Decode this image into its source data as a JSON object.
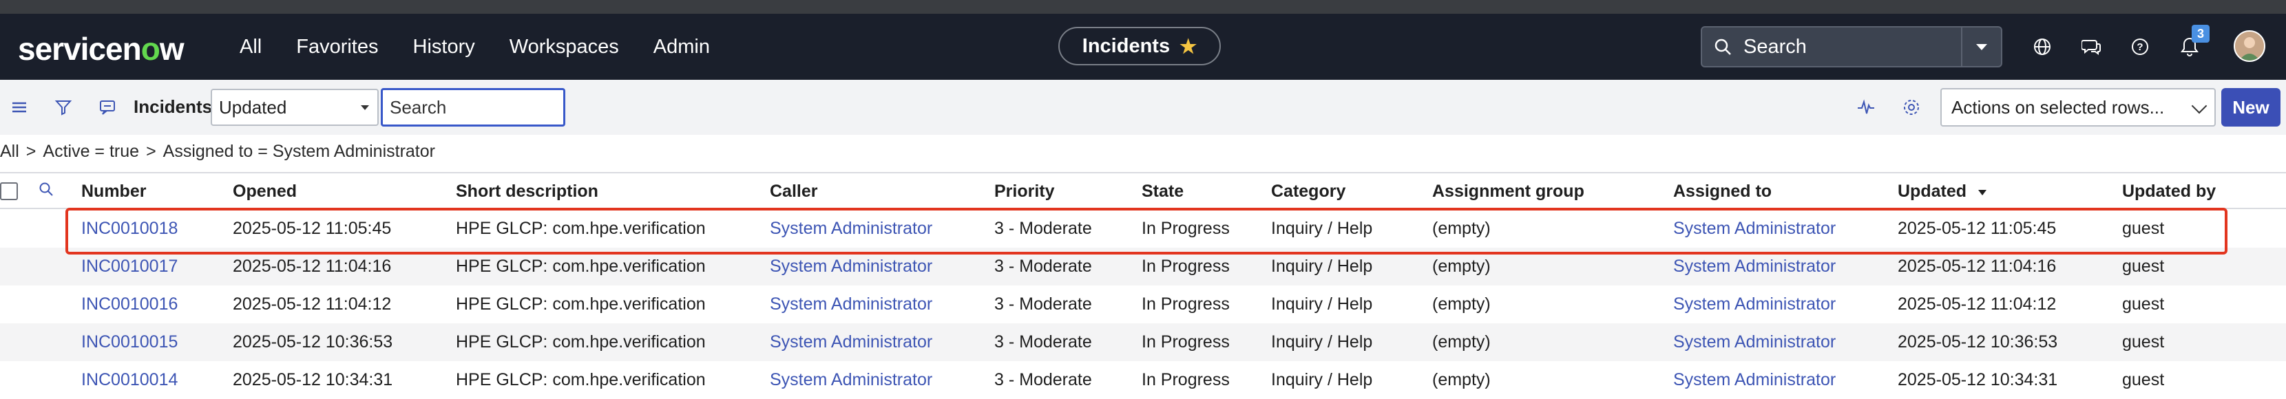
{
  "nav": {
    "logo_pre": "servicen",
    "logo_o": "o",
    "logo_post": "w",
    "menu": [
      "All",
      "Favorites",
      "History",
      "Workspaces",
      "Admin"
    ],
    "current_page": "Incidents",
    "search_placeholder": "Search",
    "notification_count": "3"
  },
  "toolbar": {
    "title": "Incidents",
    "sort_field": "Updated",
    "search_placeholder": "Search",
    "actions_label": "Actions on selected rows...",
    "new_label": "New"
  },
  "breadcrumb": {
    "items": [
      "All",
      ">",
      "Active = true",
      ">",
      "Assigned to = System Administrator"
    ]
  },
  "table": {
    "columns": [
      "Number",
      "Opened",
      "Short description",
      "Caller",
      "Priority",
      "State",
      "Category",
      "Assignment group",
      "Assigned to",
      "Updated",
      "Updated by"
    ],
    "rows": [
      [
        "INC0010018",
        "2025-05-12 11:05:45",
        "HPE GLCP: com.hpe.verification",
        "System Administrator",
        "3 - Moderate",
        "In Progress",
        "Inquiry / Help",
        "(empty)",
        "System Administrator",
        "2025-05-12 11:05:45",
        "guest"
      ],
      [
        "INC0010017",
        "2025-05-12 11:04:16",
        "HPE GLCP: com.hpe.verification",
        "System Administrator",
        "3 - Moderate",
        "In Progress",
        "Inquiry / Help",
        "(empty)",
        "System Administrator",
        "2025-05-12 11:04:16",
        "guest"
      ],
      [
        "INC0010016",
        "2025-05-12 11:04:12",
        "HPE GLCP: com.hpe.verification",
        "System Administrator",
        "3 - Moderate",
        "In Progress",
        "Inquiry / Help",
        "(empty)",
        "System Administrator",
        "2025-05-12 11:04:12",
        "guest"
      ],
      [
        "INC0010015",
        "2025-05-12 10:36:53",
        "HPE GLCP: com.hpe.verification",
        "System Administrator",
        "3 - Moderate",
        "In Progress",
        "Inquiry / Help",
        "(empty)",
        "System Administrator",
        "2025-05-12 10:36:53",
        "guest"
      ],
      [
        "INC0010014",
        "2025-05-12 10:34:31",
        "HPE GLCP: com.hpe.verification",
        "System Administrator",
        "3 - Moderate",
        "In Progress",
        "Inquiry / Help",
        "(empty)",
        "System Administrator",
        "2025-05-12 10:34:31",
        "guest"
      ]
    ],
    "highlighted_row": 0
  },
  "colors": {
    "nav_bg": "#1a1f2b",
    "link": "#3d55b4",
    "primary_button": "#3b4fb6",
    "highlight": "#e2351f",
    "logo_accent": "#62d84e"
  }
}
